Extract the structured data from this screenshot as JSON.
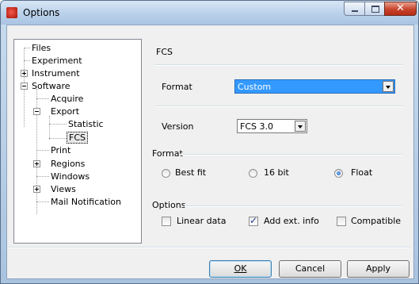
{
  "window": {
    "title": "Options"
  },
  "tree": {
    "files": "Files",
    "experiment": "Experiment",
    "instrument": "Instrument",
    "software": "Software",
    "acquire": "Acquire",
    "export": "Export",
    "statistic": "Statistic",
    "fcs": "FCS",
    "print": "Print",
    "regions": "Regions",
    "windows": "Windows",
    "views": "Views",
    "mail": "Mail Notification"
  },
  "panel": {
    "heading": "FCS",
    "format_label": "Format",
    "format_value": "Custom",
    "version_label": "Version",
    "version_value": "FCS 3.0",
    "format_group": "Format",
    "radios": [
      "Best fit",
      "16 bit",
      "Float"
    ],
    "selected_radio": "Float",
    "options_group": "Options",
    "checks": [
      {
        "label": "Linear data",
        "checked": false
      },
      {
        "label": "Add ext. info",
        "checked": true
      },
      {
        "label": "Compatible",
        "checked": false
      }
    ]
  },
  "buttons": {
    "ok": "OK",
    "cancel": "Cancel",
    "apply": "Apply"
  }
}
